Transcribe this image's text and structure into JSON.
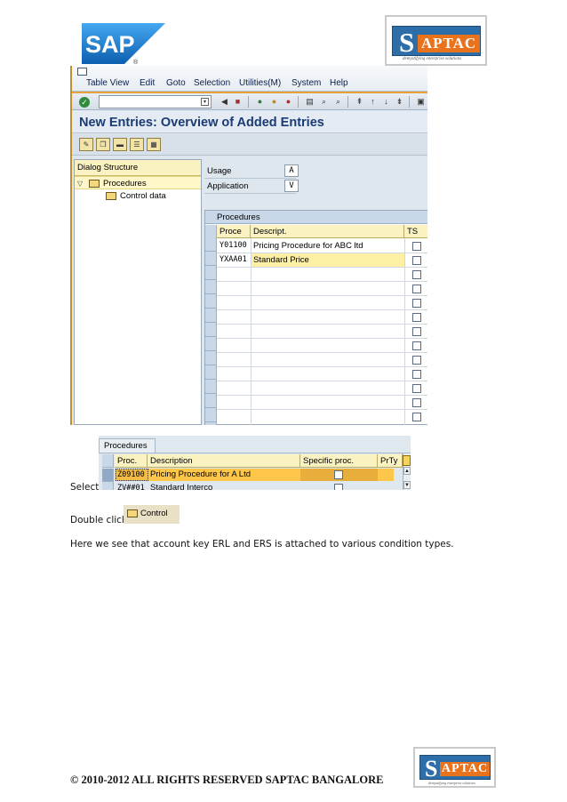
{
  "logos": {
    "sap_text": "SAP",
    "saptac_s": "S",
    "saptac_rest": "APTAC",
    "saptac_tagline": "demystifying enterprise solutions"
  },
  "sap_window": {
    "menu": [
      "Table View",
      "Edit",
      "Goto",
      "Selection",
      "Utilities(M)",
      "System",
      "Help"
    ],
    "page_title": "New Entries: Overview of Added Entries",
    "dialog_structure": {
      "header": "Dialog Structure",
      "nodes": [
        "Procedures",
        "Control data"
      ]
    },
    "fields": {
      "usage_label": "Usage",
      "usage_value": "A",
      "application_label": "Application",
      "application_value": "V"
    },
    "procedures_table": {
      "caption": "Procedures",
      "columns": [
        "Proce",
        "Descript.",
        "TS"
      ],
      "rows": [
        {
          "proc": "Y01100",
          "desc": "Pricing Procedure for ABC ltd"
        },
        {
          "proc": "YXAA01",
          "desc": "Standard Price"
        }
      ]
    }
  },
  "select_shot": {
    "tab": "Procedures",
    "columns": [
      "Proc.",
      "Description",
      "Specific proc.",
      "PrTy"
    ],
    "row1": {
      "proc": "Z09100",
      "desc": "Pricing Procedure for A Ltd"
    },
    "row2": {
      "proc": "ZV##01",
      "desc": "Standard Interco"
    }
  },
  "control_shot": {
    "label": "Control"
  },
  "text": {
    "select": "Select",
    "double_click": "Double click",
    "paragraph": "Here we see that account key ERL and ERS is attached to various condition types.",
    "footer": "© 2010-2012 ALL RIGHTS RESERVED SAPTAC BANGALORE"
  },
  "colors": {
    "sap_blue": "#1a7fd0",
    "saptac_blue": "#2d6ea8",
    "saptac_orange": "#e9721d",
    "title_blue": "#1a3b73",
    "row_highlight": "#ffc74a"
  }
}
